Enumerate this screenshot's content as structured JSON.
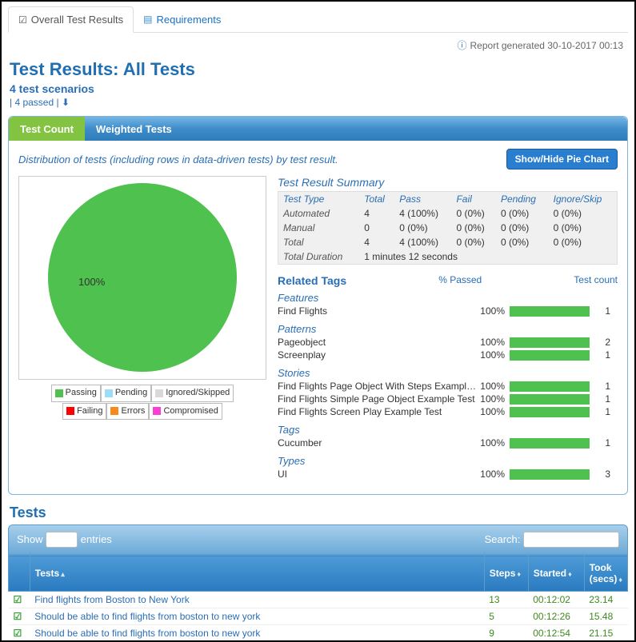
{
  "top_tabs": {
    "overall": "Overall Test Results",
    "requirements": "Requirements"
  },
  "report_gen": "Report generated 30-10-2017 00:13",
  "title": "Test Results: All Tests",
  "subtitle": "4 test scenarios",
  "pass_line": "| 4 passed |",
  "panel_tabs": {
    "count": "Test Count",
    "weighted": "Weighted Tests"
  },
  "dist_text": "Distribution of tests (including rows in data-driven tests) by test result.",
  "toggle_btn": "Show/Hide Pie Chart",
  "chart_data": {
    "type": "pie",
    "title": "",
    "categories": [
      "Passing",
      "Pending",
      "Ignored/Skipped",
      "Failing",
      "Errors",
      "Compromised"
    ],
    "values": [
      100,
      0,
      0,
      0,
      0,
      0
    ],
    "colors": [
      "#4fc14f",
      "#9addf7",
      "#d9d9d9",
      "#ff0000",
      "#f58b1f",
      "#ff3dd4"
    ]
  },
  "pie_pct": "100%",
  "legend": {
    "passing": "Passing",
    "pending": "Pending",
    "ignored": "Ignored/Skipped",
    "failing": "Failing",
    "errors": "Errors",
    "compromised": "Compromised"
  },
  "summary_h": "Test Result Summary",
  "summary_cols": {
    "type": "Test Type",
    "total": "Total",
    "pass": "Pass",
    "fail": "Fail",
    "pending": "Pending",
    "ignore": "Ignore/Skip"
  },
  "summary_rows": [
    {
      "type": "Automated",
      "total": "4",
      "pass": "4 (100%)",
      "fail": "0 (0%)",
      "pending": "0 (0%)",
      "ignore": "0 (0%)"
    },
    {
      "type": "Manual",
      "total": "0",
      "pass": "0 (0%)",
      "fail": "0 (0%)",
      "pending": "0 (0%)",
      "ignore": "0 (0%)"
    },
    {
      "type": "Total",
      "total": "4",
      "pass": "4 (100%)",
      "fail": "0 (0%)",
      "pending": "0 (0%)",
      "ignore": "0 (0%)"
    }
  ],
  "duration_label": "Total Duration",
  "duration_value": "1 minutes 12 seconds",
  "related_h": "Related Tags",
  "related_c1": "% Passed",
  "related_c2": "Test count",
  "tag_groups": [
    {
      "h": "Features",
      "rows": [
        {
          "name": "Find Flights",
          "pct": "100%",
          "ct": "1"
        }
      ]
    },
    {
      "h": "Patterns",
      "rows": [
        {
          "name": "Pageobject",
          "pct": "100%",
          "ct": "2"
        },
        {
          "name": "Screenplay",
          "pct": "100%",
          "ct": "1"
        }
      ]
    },
    {
      "h": "Stories",
      "rows": [
        {
          "name": "Find Flights Page Object With Steps Example Test",
          "pct": "100%",
          "ct": "1"
        },
        {
          "name": "Find Flights Simple Page Object Example Test",
          "pct": "100%",
          "ct": "1"
        },
        {
          "name": "Find Flights Screen Play Example Test",
          "pct": "100%",
          "ct": "1"
        }
      ]
    },
    {
      "h": "Tags",
      "rows": [
        {
          "name": "Cucumber",
          "pct": "100%",
          "ct": "1"
        }
      ]
    },
    {
      "h": "Types",
      "rows": [
        {
          "name": "UI",
          "pct": "100%",
          "ct": "3"
        }
      ]
    }
  ],
  "tests_h": "Tests",
  "controls": {
    "show": "Show",
    "entries": "entries",
    "search": "Search:"
  },
  "table_cols": {
    "tests": "Tests",
    "steps": "Steps",
    "started": "Started",
    "took": "Took (secs)"
  },
  "test_rows": [
    {
      "name": "Find flights from Boston to New York",
      "steps": "13",
      "started": "00:12:02",
      "took": "23.14"
    },
    {
      "name": "Should be able to find flights from boston to new york",
      "steps": "5",
      "started": "00:12:26",
      "took": "15.48"
    },
    {
      "name": "Should be able to find flights from boston to new york",
      "steps": "9",
      "started": "00:12:54",
      "took": "21.15"
    }
  ]
}
